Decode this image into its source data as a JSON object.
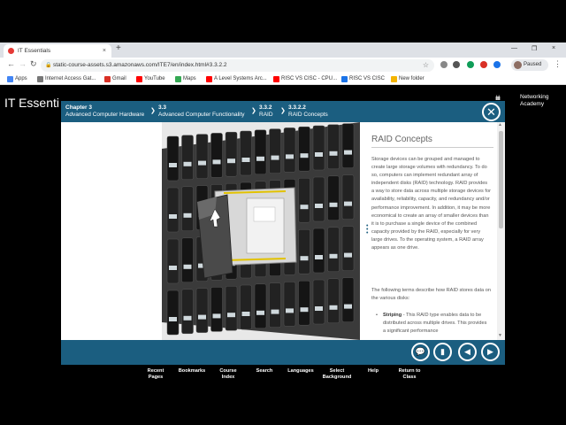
{
  "browser": {
    "tab_title": "IT Essentials",
    "tab_close": "×",
    "new_tab": "+",
    "window_controls": [
      "—",
      "❐",
      "×"
    ],
    "url": "static-course-assets.s3.amazonaws.com/ITE7/en/index.html#3.3.2.2",
    "profile_label": "Paused",
    "menu": "⋮",
    "bookmarks": [
      {
        "label": "Apps",
        "color": "#4285f4"
      },
      {
        "label": "Internet Access Gat...",
        "color": "#777"
      },
      {
        "label": "Gmail",
        "color": "#d93025"
      },
      {
        "label": "YouTube",
        "color": "#ff0000"
      },
      {
        "label": "Maps",
        "color": "#34a853"
      },
      {
        "label": "A Level Systems Arc...",
        "color": "#ff0000"
      },
      {
        "label": "RISC VS CISC - CPU...",
        "color": "#ff0000"
      },
      {
        "label": "RISC VS CISC",
        "color": "#1a73e8"
      },
      {
        "label": "New folder",
        "color": "#f4b400"
      }
    ]
  },
  "app": {
    "title": "IT Essenti",
    "brand_line1": "Networking",
    "brand_line2": "Academy",
    "brand_logo": "ılıılı",
    "breadcrumbs": [
      {
        "num": "Chapter 3",
        "label": "Advanced Computer Hardware"
      },
      {
        "num": "3.3",
        "label": "Advanced Computer Functionality"
      },
      {
        "num": "3.3.2",
        "label": "RAID"
      },
      {
        "num": "3.3.2.2",
        "label": "RAID Concepts"
      }
    ],
    "close_glyph": "✕",
    "content": {
      "title": "RAID Concepts",
      "para1": "Storage devices can be grouped and managed to create large storage volumes with redundancy. To do so, computers can implement redundant array of independent disks (RAID) technology. RAID provides a way to store data across multiple storage devices for availability, reliability, capacity, and redundancy and/or performance improvement. In addition, it may be more economical to create an array of smaller devices than it is to purchase a single device of the combined capacity provided by the RAID, especially for very large drives. To the operating system, a RAID array appears as one drive.",
      "para2": "The following terms describe how RAID stores data on the various disks:",
      "bullet_term": "Striping",
      "bullet_text": " - This RAID type enables data to be distributed across multiple drives. This provides a significant performance"
    },
    "controls": [
      {
        "name": "glossary-button",
        "glyph": "💬"
      },
      {
        "name": "bookmark-button",
        "glyph": "▮"
      },
      {
        "name": "previous-button",
        "glyph": "◀"
      },
      {
        "name": "next-button",
        "glyph": "▶"
      }
    ],
    "nav": [
      {
        "l1": "Recent",
        "l2": "Pages"
      },
      {
        "l1": "Bookmarks",
        "l2": ""
      },
      {
        "l1": "Course",
        "l2": "Index"
      },
      {
        "l1": "Search",
        "l2": ""
      },
      {
        "l1": "Languages",
        "l2": ""
      },
      {
        "l1": "Select",
        "l2": "Background"
      },
      {
        "l1": "Help",
        "l2": ""
      },
      {
        "l1": "Return to",
        "l2": "Class"
      }
    ]
  }
}
